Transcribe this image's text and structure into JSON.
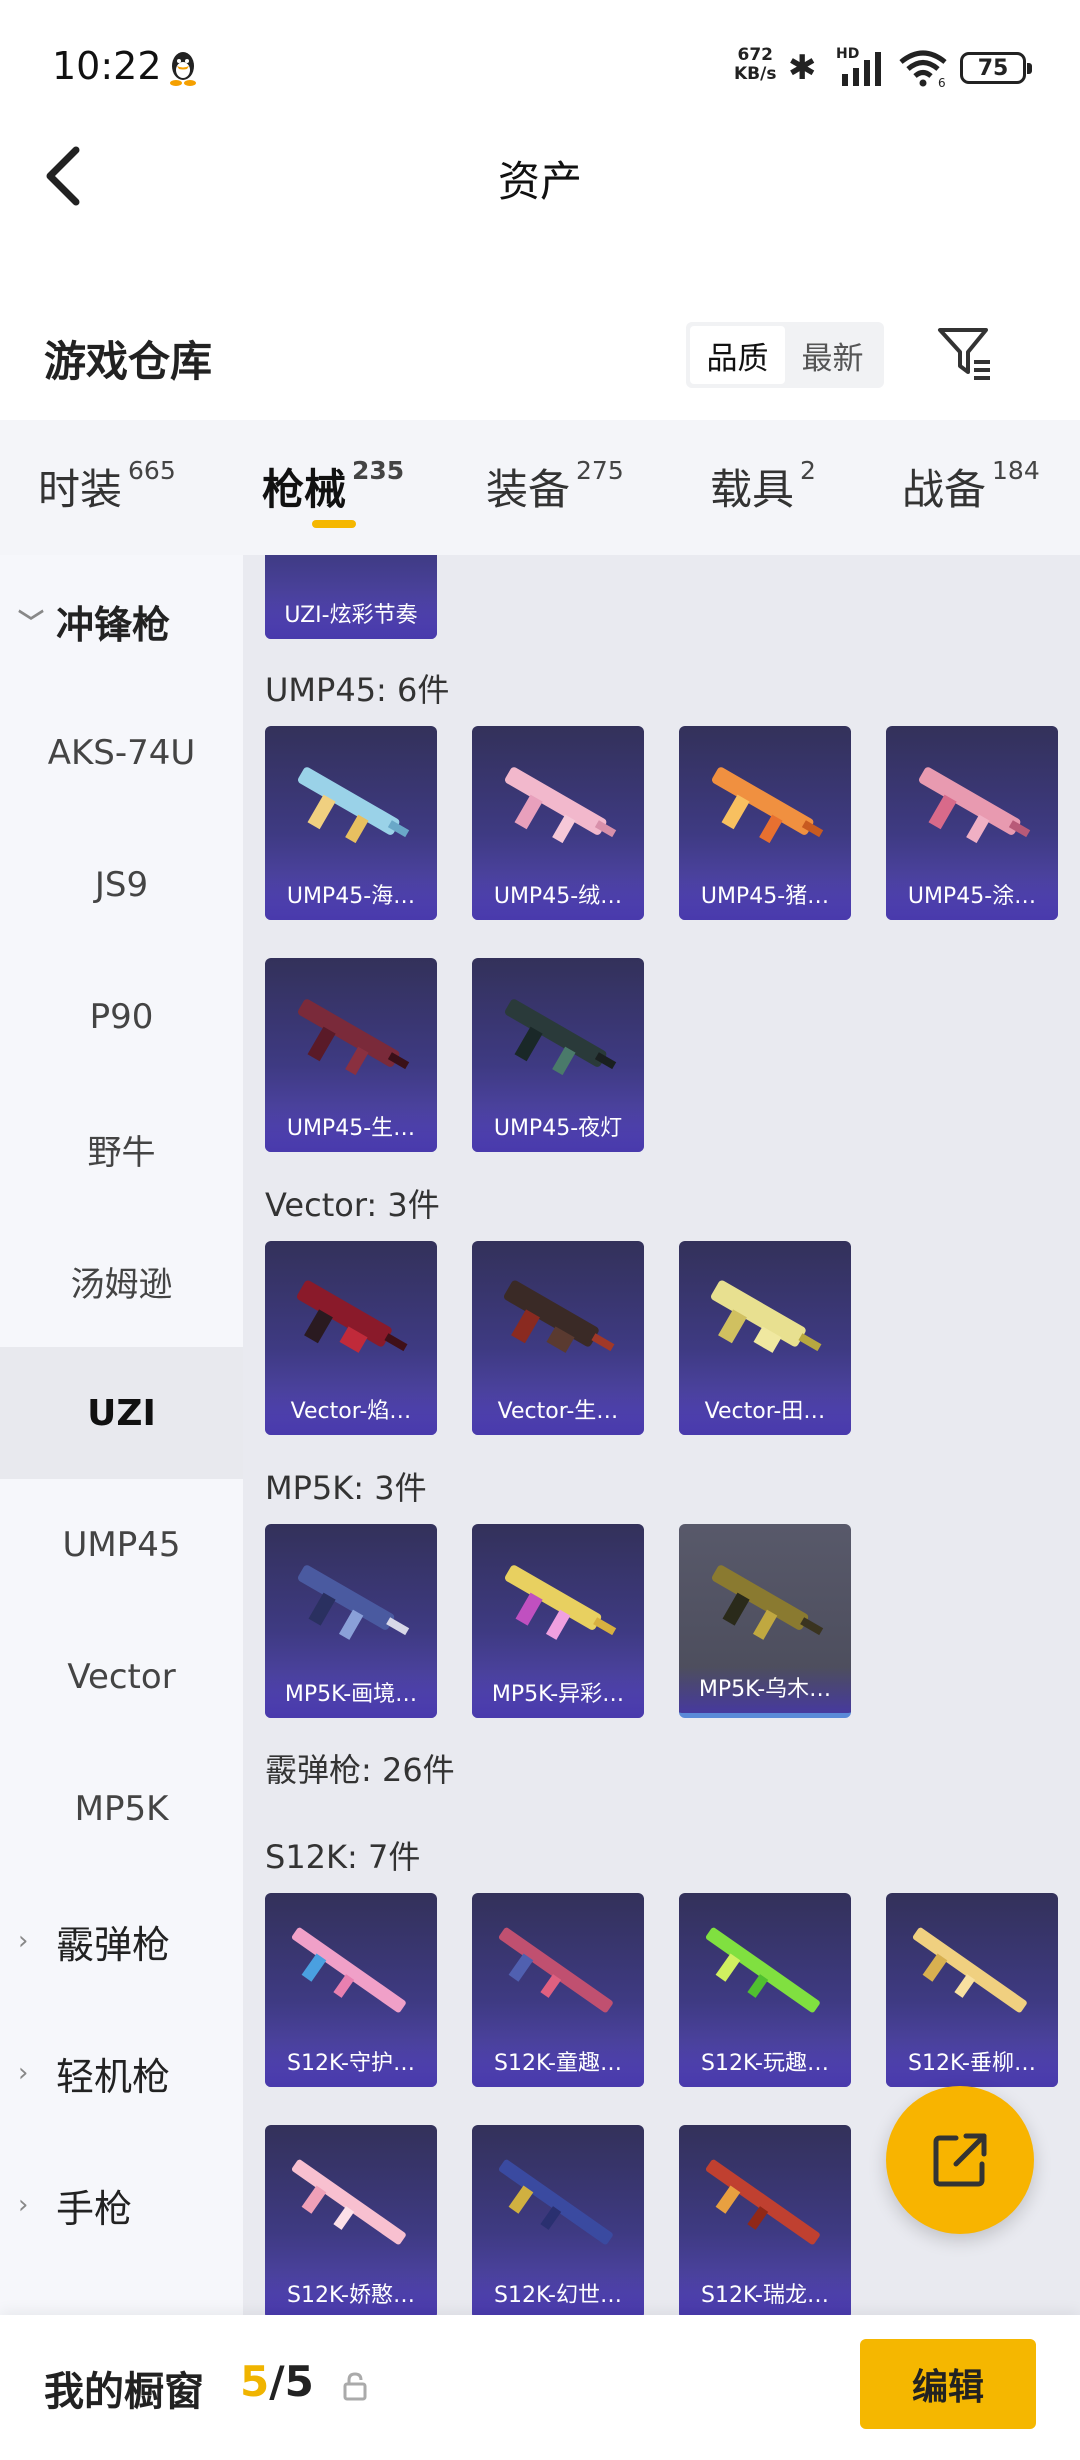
{
  "status_bar": {
    "time": "10:22",
    "net_speed_value": "672",
    "net_speed_unit": "KB/s",
    "signal_tag": "HD",
    "wifi_tag": "6",
    "battery": "75"
  },
  "header": {
    "title": "资产",
    "back_icon": "chevron-left-icon"
  },
  "warehouse": {
    "title": "游戏仓库",
    "sort_options": [
      "品质",
      "最新"
    ],
    "sort_selected": "品质",
    "filter_icon": "filter-list-icon"
  },
  "tabs": [
    {
      "label": "时装",
      "count": "665"
    },
    {
      "label": "枪械",
      "count": "235",
      "active": true
    },
    {
      "label": "装备",
      "count": "275"
    },
    {
      "label": "载具",
      "count": "2"
    },
    {
      "label": "战备",
      "count": "184"
    }
  ],
  "sidebar": {
    "group_open": {
      "label": "冲锋枪",
      "icon": "chevron-down-icon"
    },
    "items": [
      "AKS-74U",
      "JS9",
      "P90",
      "野牛",
      "汤姆逊",
      "UZI",
      "UMP45",
      "Vector",
      "MP5K"
    ],
    "selected": "UZI",
    "groups_closed": [
      {
        "label": "霰弹枪",
        "icon": "chevron-right-icon"
      },
      {
        "label": "轻机枪",
        "icon": "chevron-right-icon"
      },
      {
        "label": "手枪",
        "icon": "chevron-right-icon"
      }
    ]
  },
  "content": {
    "partial_card": "UZI-炫彩节奏",
    "sections": [
      {
        "title": "UMP45: 6件",
        "items": [
          "UMP45-海…",
          "UMP45-绒…",
          "UMP45-猪…",
          "UMP45-涂…",
          "UMP45-生…",
          "UMP45-夜灯"
        ]
      },
      {
        "title": "Vector: 3件",
        "items": [
          "Vector-焰…",
          "Vector-生…",
          "Vector-田…"
        ]
      },
      {
        "title": "MP5K: 3件",
        "items": [
          "MP5K-画境…",
          "MP5K-异彩…",
          "MP5K-乌木…"
        ]
      }
    ],
    "category_title": "霰弹枪: 26件",
    "sub_section": {
      "title": "S12K: 7件",
      "items": [
        "S12K-守护…",
        "S12K-童趣…",
        "S12K-玩趣…",
        "S12K-垂柳…",
        "S12K-娇憨…",
        "S12K-幻世…",
        "S12K-瑞龙…"
      ]
    }
  },
  "fab": {
    "icon": "share-external-icon"
  },
  "bottom_bar": {
    "title": "我的橱窗",
    "count_current": "5",
    "count_total": "/5",
    "lock_icon": "lock-icon",
    "edit_label": "编辑"
  },
  "colors": {
    "accent": "#f5b700",
    "card_purple": "#4a3fa0",
    "sidebar_bg": "#f6f7fb",
    "content_bg": "#e9eaf0"
  }
}
